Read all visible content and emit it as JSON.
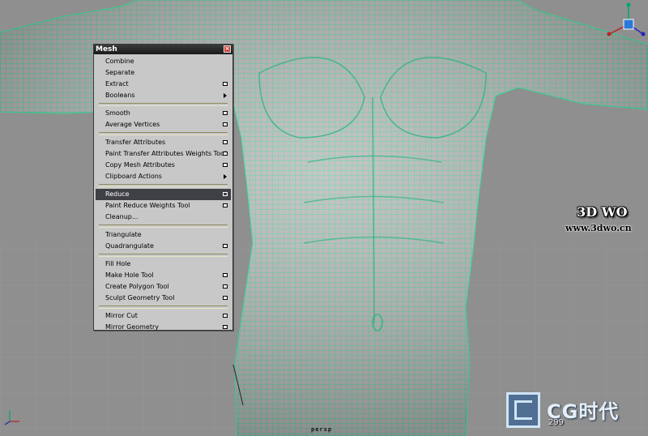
{
  "viewport": {
    "camera_label": "persp"
  },
  "mesh_menu": {
    "title": "Mesh",
    "groups": [
      [
        {
          "label": "Combine",
          "suffix": "none"
        },
        {
          "label": "Separate",
          "suffix": "none"
        },
        {
          "label": "Extract",
          "suffix": "option-box"
        },
        {
          "label": "Booleans",
          "suffix": "submenu-arrow"
        }
      ],
      [
        {
          "label": "Smooth",
          "suffix": "option-box"
        },
        {
          "label": "Average Vertices",
          "suffix": "option-box"
        }
      ],
      [
        {
          "label": "Transfer Attributes",
          "suffix": "option-box"
        },
        {
          "label": "Paint Transfer Attributes Weights Tool",
          "suffix": "option-box"
        },
        {
          "label": "Copy Mesh Attributes",
          "suffix": "option-box"
        },
        {
          "label": "Clipboard Actions",
          "suffix": "submenu-arrow"
        }
      ],
      [
        {
          "label": "Reduce",
          "suffix": "option-box",
          "selected": true
        },
        {
          "label": "Paint Reduce Weights Tool",
          "suffix": "option-box"
        },
        {
          "label": "Cleanup...",
          "suffix": "none"
        }
      ],
      [
        {
          "label": "Triangulate",
          "suffix": "none"
        },
        {
          "label": "Quadrangulate",
          "suffix": "option-box"
        }
      ],
      [
        {
          "label": "Fill Hole",
          "suffix": "none"
        },
        {
          "label": "Make Hole Tool",
          "suffix": "option-box"
        },
        {
          "label": "Create Polygon Tool",
          "suffix": "option-box"
        },
        {
          "label": "Sculpt Geometry Tool",
          "suffix": "option-box"
        }
      ],
      [
        {
          "label": "Mirror Cut",
          "suffix": "option-box"
        },
        {
          "label": "Mirror Geometry",
          "suffix": "option-box"
        }
      ]
    ]
  },
  "watermarks": {
    "brand_3dwo": "3D WO",
    "url_3dwo": "www.3dwo.cn",
    "cg_brand": "CG时代",
    "cg_number": "299"
  },
  "colors": {
    "viewport_bg": "#8f8f8f",
    "wireframe": "#2fe39a",
    "menu_bg": "#c8c8c8",
    "menu_selected": "#3f3f46"
  }
}
